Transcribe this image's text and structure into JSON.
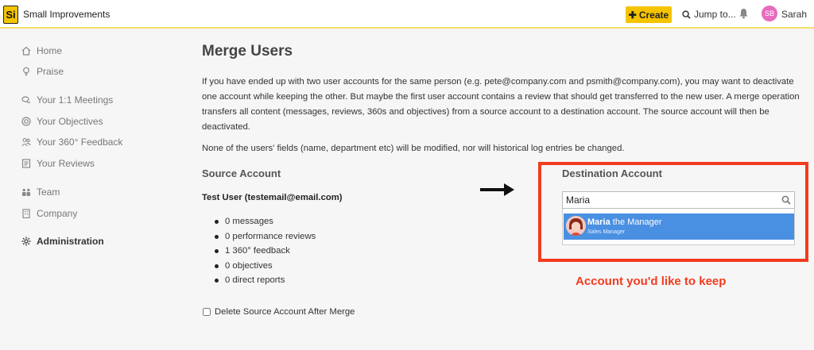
{
  "app": {
    "logo": "Si",
    "title": "Small Improvements"
  },
  "topbar": {
    "create_label": "Create",
    "jump_label": "Jump to...",
    "avatar_initials": "SB",
    "user_name": "Sarah"
  },
  "sidebar": {
    "items": [
      {
        "label": "Home",
        "icon": "home-icon"
      },
      {
        "label": "Praise",
        "icon": "lightbulb-icon"
      },
      {
        "label": "Your 1:1 Meetings",
        "icon": "chat-icon"
      },
      {
        "label": "Your Objectives",
        "icon": "target-icon"
      },
      {
        "label": "Your 360° Feedback",
        "icon": "people-icon"
      },
      {
        "label": "Your Reviews",
        "icon": "document-icon"
      },
      {
        "label": "Team",
        "icon": "team-icon"
      },
      {
        "label": "Company",
        "icon": "building-icon"
      },
      {
        "label": "Administration",
        "icon": "gear-icon",
        "active": true
      }
    ]
  },
  "main": {
    "title": "Merge Users",
    "intro": "If you have ended up with two user accounts for the same person (e.g. pete@company.com and psmith@company.com), you may want to deactivate one account while keeping the other. But maybe the first user account contains a review that should get transferred to the new user. A merge operation transfers all content (messages, reviews, 360s and objectives) from a source account to a destination account. The source account will then be deactivated.",
    "note": "None of the users' fields (name, department etc) will be modified, nor will historical log entries be changed.",
    "source": {
      "heading": "Source Account",
      "user": "Test User (testemail@email.com)",
      "stats": [
        "0 messages",
        "0 performance reviews",
        "1 360° feedback",
        "0 objectives",
        "0 direct reports"
      ],
      "delete_label": "Delete Source Account After Merge"
    },
    "destination": {
      "heading": "Destination Account",
      "search_value": "Maria",
      "result": {
        "name_match": "Maria",
        "name_rest": " the Manager",
        "role": "Sales Manager"
      }
    },
    "annotation": "Account you'd like to keep"
  },
  "colors": {
    "accent": "#f5c400",
    "highlight": "#4a90e2",
    "annotation": "#f33b1f"
  }
}
